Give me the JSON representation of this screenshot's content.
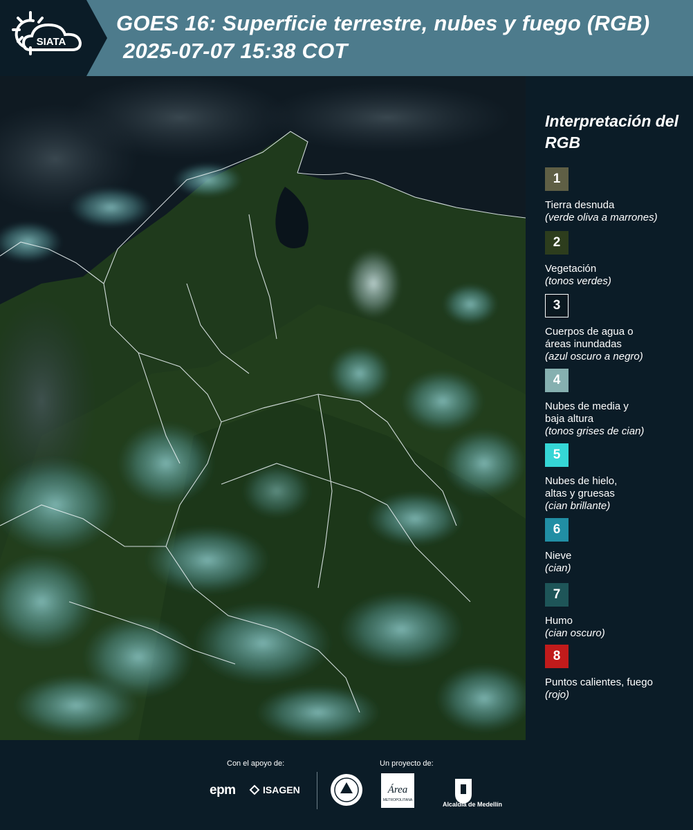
{
  "header": {
    "title_line1": "GOES 16: Superficie terrestre, nubes y fuego (RGB)",
    "title_line2": "2025-07-07 15:38 COT",
    "logo_text": "SIATA",
    "background_color": "#4d7b8c"
  },
  "legend": {
    "title": "Interpretación del RGB",
    "items": [
      {
        "number": "1",
        "label": "Tierra desnuda",
        "sub": "(verde oliva a marrones)",
        "color": "#5f5f45"
      },
      {
        "number": "2",
        "label": "Vegetación",
        "sub": "(tonos verdes)",
        "color": "#2d3d1d"
      },
      {
        "number": "3",
        "label": "Cuerpos de agua o\náreas inundadas",
        "sub": "(azul oscuro a negro)",
        "color": "#0a1820"
      },
      {
        "number": "4",
        "label": "Nubes de media y\nbaja altura",
        "sub": "(tonos grises de cian)",
        "color": "#86b0b0"
      },
      {
        "number": "5",
        "label": "Nubes de hielo,\naltas y gruesas",
        "sub": "(cian brillante)",
        "color": "#35d6d6"
      },
      {
        "number": "6",
        "label": "Nieve",
        "sub": "(cian)",
        "color": "#218ea4"
      },
      {
        "number": "7",
        "label": "Humo",
        "sub": "(cian oscuro)",
        "color": "#1e5558"
      },
      {
        "number": "8",
        "label": "Puntos calientes, fuego",
        "sub": "(rojo)",
        "color": "#c11b1b"
      }
    ]
  },
  "footer": {
    "support_label": "Con el apoyo de:",
    "project_label": "Un proyecto de:",
    "epm": "epm",
    "isagen": "ISAGEN",
    "medellin": "Alcaldía de Medellín",
    "metro_word": "Área",
    "metro_sub": "METROPOLITANA"
  }
}
